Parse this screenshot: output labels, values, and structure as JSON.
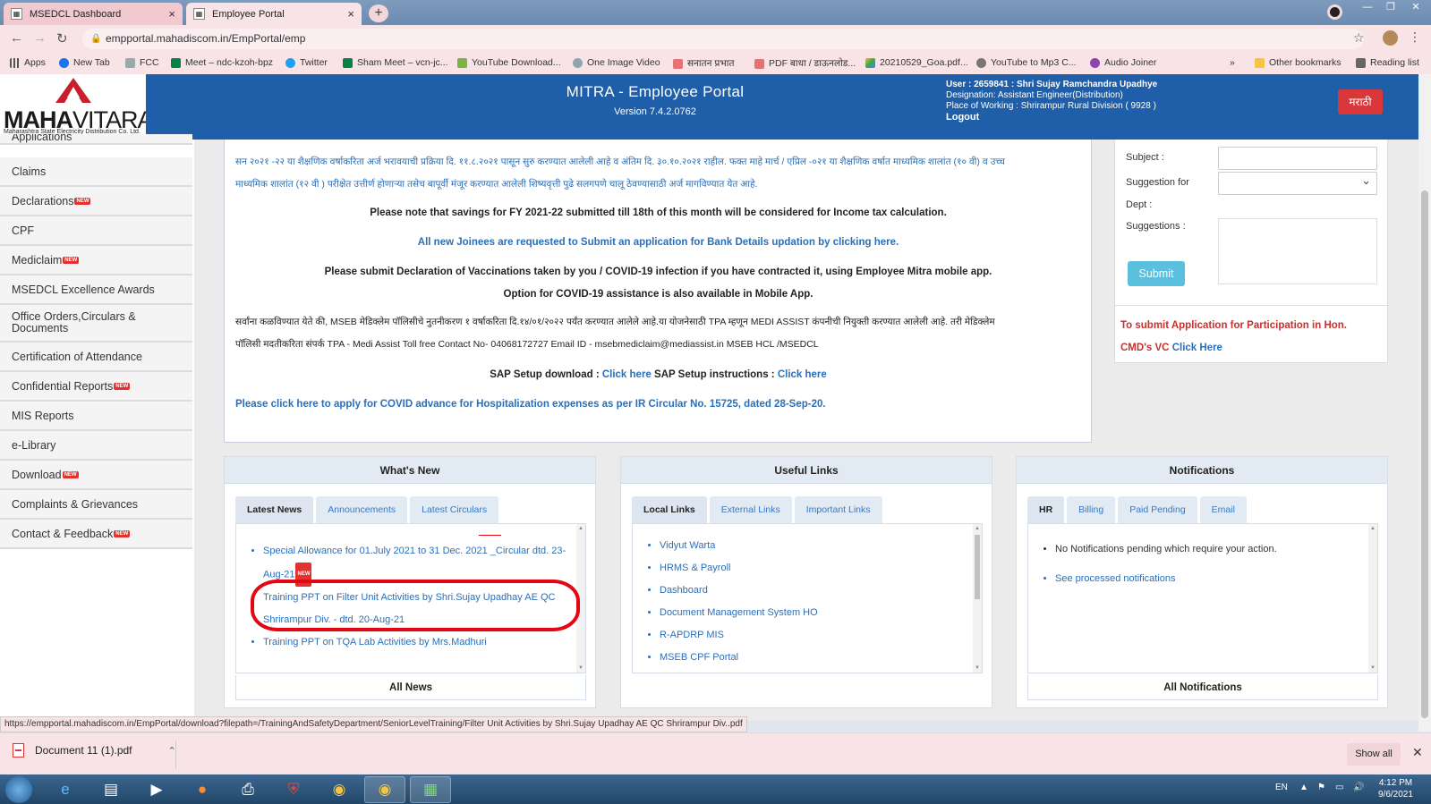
{
  "browser": {
    "tabs": [
      {
        "title": "MSEDCL Dashboard",
        "active": false
      },
      {
        "title": "Employee Portal",
        "active": true
      }
    ],
    "url": "empportal.mahadiscom.in/EmpPortal/emp",
    "bookmarks": [
      "Apps",
      "New Tab",
      "FCC",
      "Meet – ndc-kzoh-bpz",
      "Twitter",
      "Sham Meet – vcn-jc...",
      "YouTube Download...",
      "One Image Video",
      "सनातन प्रभात",
      "PDF बाधा / डाऊनलोड...",
      "20210529_Goa.pdf...",
      "YouTube to Mp3 C...",
      "Audio Joiner"
    ],
    "bookmarks_more": "»",
    "other_bookmarks": "Other bookmarks",
    "reading_list": "Reading list"
  },
  "header": {
    "logo_text_bold": "MAHA",
    "logo_text_light": "VITARAN",
    "logo_sub": "Maharashtra State Electricity Distribution Co. Ltd.",
    "title": "MITRA - Employee Portal",
    "version": "Version 7.4.2.0762",
    "user_line": "User : 2659841 : Shri Sujay Ramchandra Upadhye",
    "designation_line": "Designation: Assistant Engineer(Distribution)",
    "workplace_line": "Place of Working : Shrirampur Rural Division ( 9928 )",
    "logout": "Logout",
    "lang_button": "मराठी"
  },
  "sidebar": {
    "badge": "NEW",
    "items": [
      {
        "label": "Applications",
        "new": false
      },
      {
        "label": "Claims",
        "new": false
      },
      {
        "label": "Declarations",
        "new": true
      },
      {
        "label": "CPF",
        "new": false
      },
      {
        "label": "Mediclaim",
        "new": true
      },
      {
        "label": "MSEDCL Excellence Awards",
        "new": false
      },
      {
        "label": "Office Orders,Circulars & Documents",
        "new": false
      },
      {
        "label": "Certification of Attendance",
        "new": false
      },
      {
        "label": "Confidential Reports",
        "new": true
      },
      {
        "label": "MIS Reports",
        "new": false
      },
      {
        "label": "e-Library",
        "new": false
      },
      {
        "label": "Download",
        "new": true
      },
      {
        "label": "Complaints & Grievances",
        "new": false
      },
      {
        "label": "Contact & Feedback",
        "new": true
      }
    ]
  },
  "notices": {
    "hindi_1": "सन २०२१ -२२ या शैक्षणिक वर्षाकरिता अर्ज भरावयाची प्रक्रिया दि. ११.८.२०२१ पासून सुरु करण्यात आलेली आहे व अंतिम दि. ३०.१०.२०२१ राहील. फक्त माहे मार्च / एप्रिल -०२१ या शैक्षणिक वर्षात माध्यमिक शालांत (१० वी) व उच्च",
    "hindi_2": "माध्यमिक शालांत (१२ वी ) परीक्षेत उत्तीर्ण होणाऱ्या तसेच बापूर्वी मंजूर करण्यात आलेली शिष्यवृत्ती पुढे सलगपणे चालू ठेवण्यासाठी अर्ज मागविण्यात येत आहे.",
    "savings": "Please note that savings for FY 2021-22 submitted till 18th of this month will be considered for Income tax calculation.",
    "joinees": "All new Joinees are requested to Submit an application for Bank Details updation by clicking here.",
    "vaccination": "Please submit Declaration of Vaccinations taken by you / COVID-19 infection if you have contracted it, using Employee Mitra mobile app.",
    "covid_option": "Option for COVID-19 assistance is also available in Mobile App.",
    "hindi_3": "सर्वांना कळविण्यात येते की, MSEB मेडिक्लेम पॉलिसीचे नुतनीकरण १ वर्षाकरिता दि.१४/०१/२०२२ पर्यंत करण्यात आलेले आहे.या योजनेसाठी TPA म्हणून MEDI ASSIST कंपनीची नियुक्ती करण्यात आलेली आहे. तरी मेडिक्लेम",
    "hindi_4": "पॉलिसी मदतीकरिता संपर्क TPA - Medi Assist Toll free Contact No- 04068172727 Email ID - msebmediclaim@mediassist.in MSEB HCL /MSEDCL",
    "sap_label_1": "SAP Setup download : ",
    "sap_link_1": "Click here",
    "sap_label_2": " SAP Setup instructions : ",
    "sap_link_2": "Click here",
    "covid_advance": "Please click here to apply for COVID advance for Hospitalization expenses as per IR Circular No. 15725, dated 28-Sep-20."
  },
  "suggestion": {
    "subject_label": "Subject :",
    "for_label": "Suggestion for",
    "dept_label": "Dept :",
    "suggestions_label": "Suggestions :",
    "submit": "Submit",
    "cmd_text": "To submit Application for Participation in Hon. CMD's VC",
    "cmd_link": "Click Here"
  },
  "widgets": {
    "whats_new": {
      "title": "What's New",
      "tabs": [
        "Latest News",
        "Announcements",
        "Latest Circulars"
      ],
      "items": [
        "Special Allowance for 01.July 2021 to 31 Dec. 2021 _Circular dtd. 23-Aug-21",
        "Training PPT on Filter Unit Activities by Shri.Sujay Upadhay AE QC Shrirampur Div. - dtd. 20-Aug-21",
        "Training PPT on TQA Lab Activities by Mrs.Madhuri"
      ],
      "footer": "All News"
    },
    "useful_links": {
      "title": "Useful Links",
      "tabs": [
        "Local Links",
        "External Links",
        "Important Links"
      ],
      "items": [
        "Vidyut Warta",
        "HRMS & Payroll",
        "Dashboard",
        "Document Management System HO",
        "R-APDRP MIS",
        "MSEB CPF Portal"
      ]
    },
    "notifications": {
      "title": "Notifications",
      "tabs": [
        "HR",
        "Billing",
        "Paid Pending",
        "Email"
      ],
      "items": [
        "No Notifications pending which require your action.",
        "See processed notifications"
      ],
      "footer": "All Notifications"
    }
  },
  "status_url": "https://empportal.mahadiscom.in/EmpPortal/download?filepath=/TrainingAndSafetyDepartment/SeniorLevelTraining/Filter Unit Activities by Shri.Sujay Upadhay AE QC Shrirampur Div..pdf",
  "downloads": {
    "file": "Document 11 (1).pdf",
    "show_all": "Show all"
  },
  "taskbar": {
    "lang": "EN",
    "time": "4:12 PM",
    "date": "9/6/2021"
  },
  "colors": {
    "header_blue": "#1f5ea8",
    "link_blue": "#2a6fba",
    "new_badge_red": "#e3312d",
    "annotation_red": "#e30613",
    "submit_cyan": "#5bc0de"
  }
}
